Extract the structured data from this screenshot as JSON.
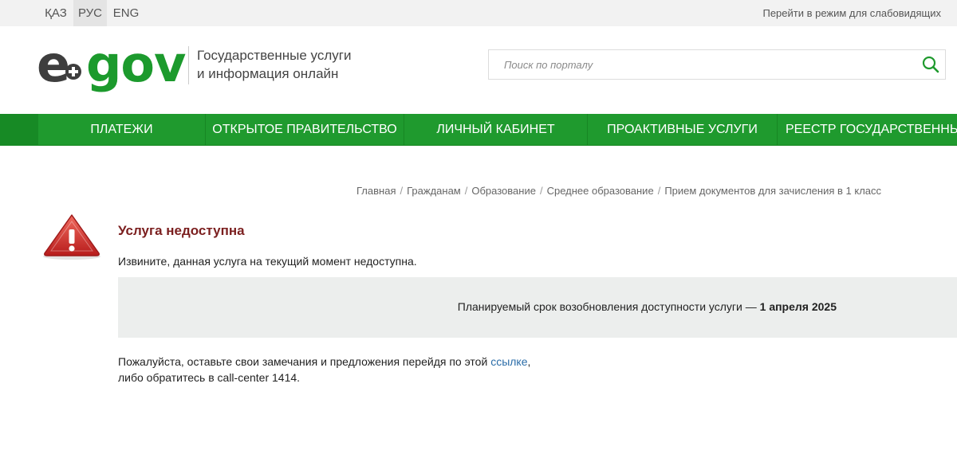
{
  "topbar": {
    "languages": [
      "ҚАЗ",
      "РУС",
      "ENG"
    ],
    "active_language": "РУС",
    "accessibility_link": "Перейти в режим для слабовидящих"
  },
  "header": {
    "logo_text_e": "e",
    "logo_text_gov": "gov",
    "tagline_line1": "Государственные услуги",
    "tagline_line2": "и информация онлайн",
    "search_placeholder": "Поиск по порталу",
    "search_icon": "search-icon"
  },
  "nav": {
    "items": [
      "ПЛАТЕЖИ",
      "ОТКРЫТОЕ ПРАВИТЕЛЬСТВО",
      "ЛИЧНЫЙ КАБИНЕТ",
      "ПРОАКТИВНЫЕ УСЛУГИ",
      "РЕЕСТР ГОСУДАРСТВЕННЫХ"
    ]
  },
  "breadcrumb": {
    "items": [
      "Главная",
      "Гражданам",
      "Образование",
      "Среднее образование",
      "Прием документов для зачисления в 1 класс"
    ]
  },
  "content": {
    "title": "Услуга недоступна",
    "subtitle": "Извините, данная услуга на текущий момент недоступна.",
    "notice_text": "Планируемый срок возобновления доступности услуги — ",
    "notice_date": "1 апреля 2025",
    "feedback_line1_start": "Пожалуйста, оставьте свои замечания и предложения перейдя по этой ",
    "feedback_link": "ссылке",
    "feedback_line1_end": ",",
    "feedback_line2": "либо обратитесь в call-center 1414."
  },
  "colors": {
    "brand_green": "#1f9a2e",
    "title_red": "#7b1f1f",
    "link_blue": "#2a6ca8",
    "warning_red": "#d32a2a"
  }
}
